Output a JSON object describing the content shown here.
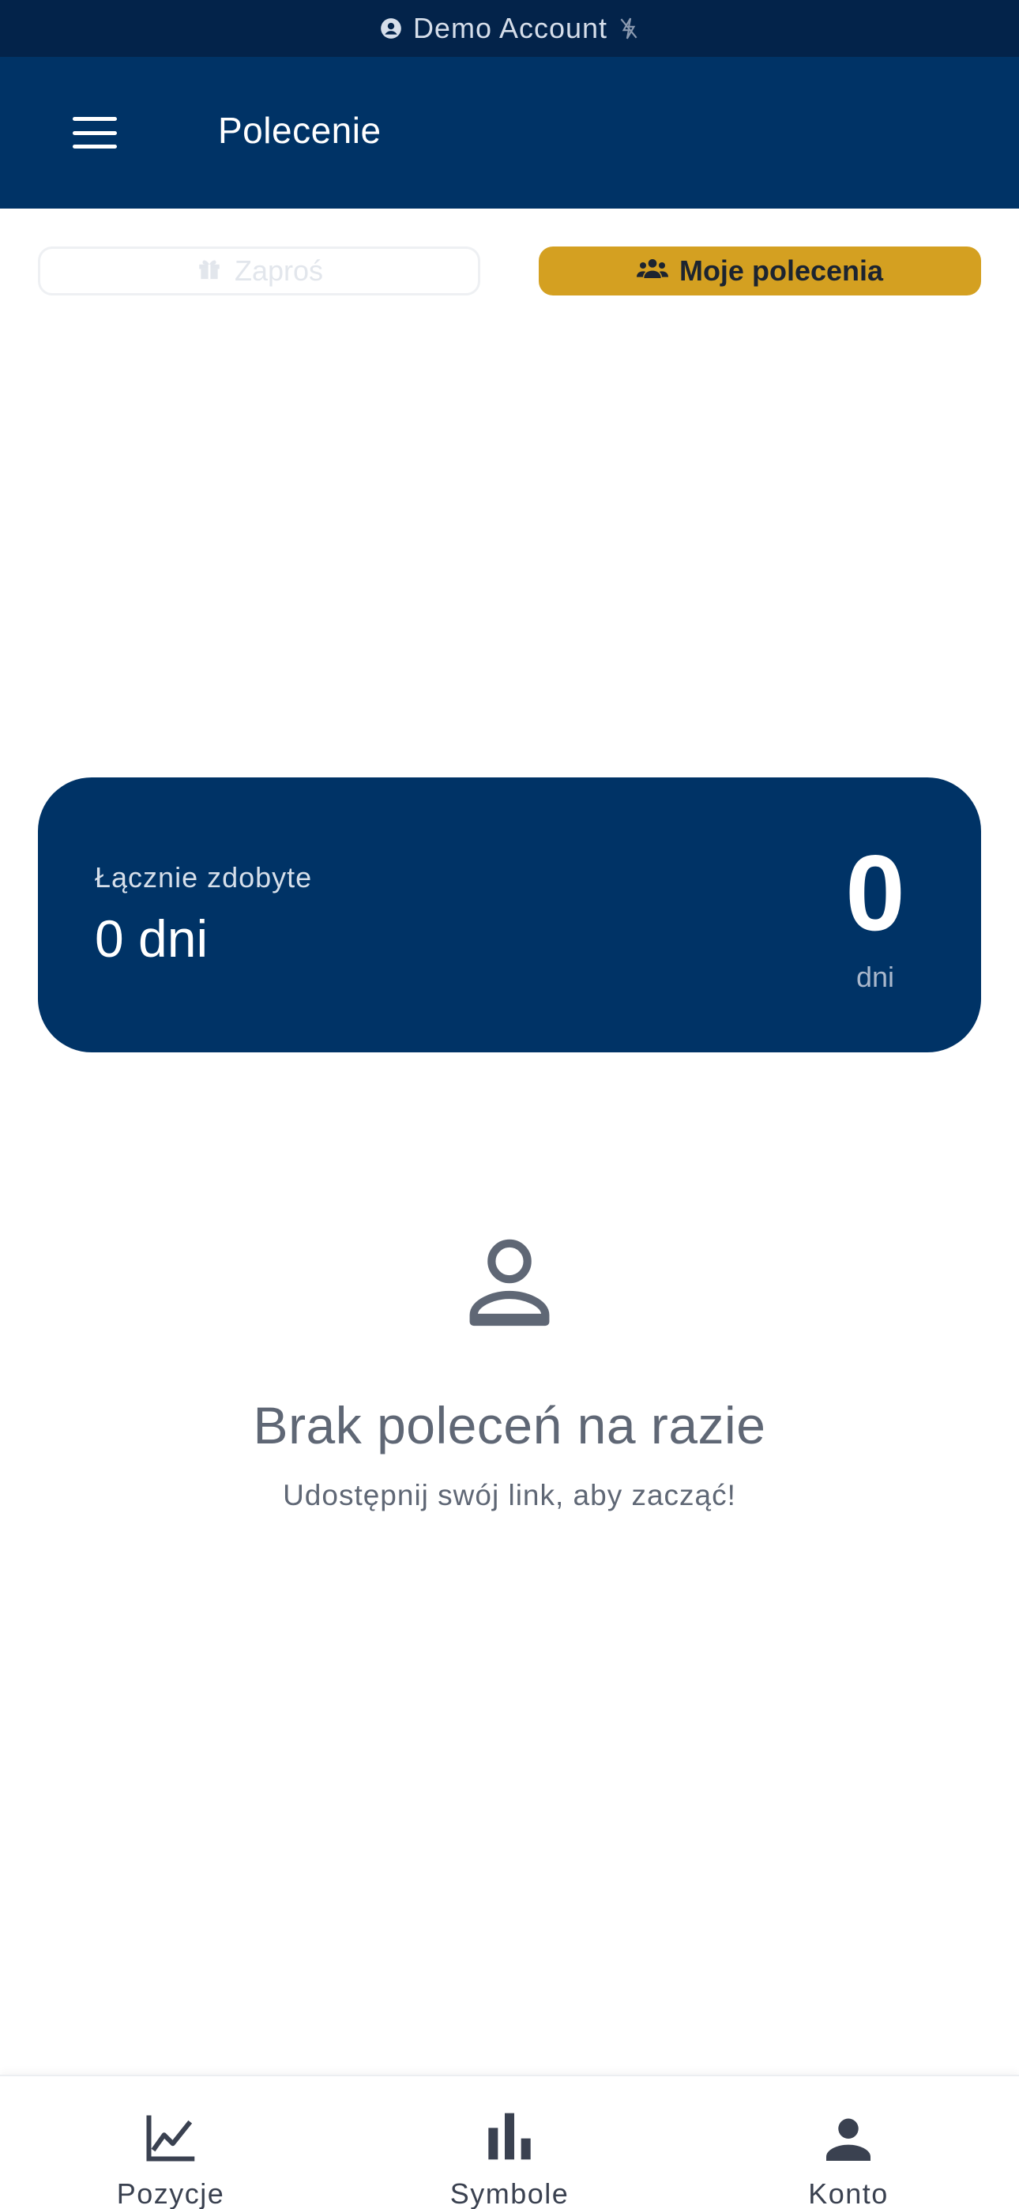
{
  "status_bar": {
    "account_label": "Demo Account",
    "account_icon": "account-circle-icon",
    "status_icon": "connection-off-icon"
  },
  "header": {
    "title": "Polecenie",
    "menu_icon": "hamburger-menu-icon"
  },
  "tabs": [
    {
      "label": "Zaproś",
      "icon": "gift-icon",
      "active": false
    },
    {
      "label": "Moje polecenia",
      "icon": "people-icon",
      "active": true
    }
  ],
  "summary": {
    "label": "Łącznie zdobyte",
    "value": "0 dni",
    "big_number": "0",
    "unit": "dni"
  },
  "empty_state": {
    "icon": "person-outline-icon",
    "title": "Brak poleceń na razie",
    "subtitle": "Udostępnij swój link, aby zacząć!"
  },
  "bottom_nav": [
    {
      "label": "Pozycje",
      "icon": "line-chart-icon"
    },
    {
      "label": "Symbole",
      "icon": "bar-chart-icon"
    },
    {
      "label": "Konto",
      "icon": "person-icon"
    }
  ],
  "colors": {
    "status_bar_bg": "#03234a",
    "header_bg": "#003366",
    "accent_gold": "#d4a021",
    "card_bg": "#003366",
    "muted_text": "#5f6775"
  }
}
